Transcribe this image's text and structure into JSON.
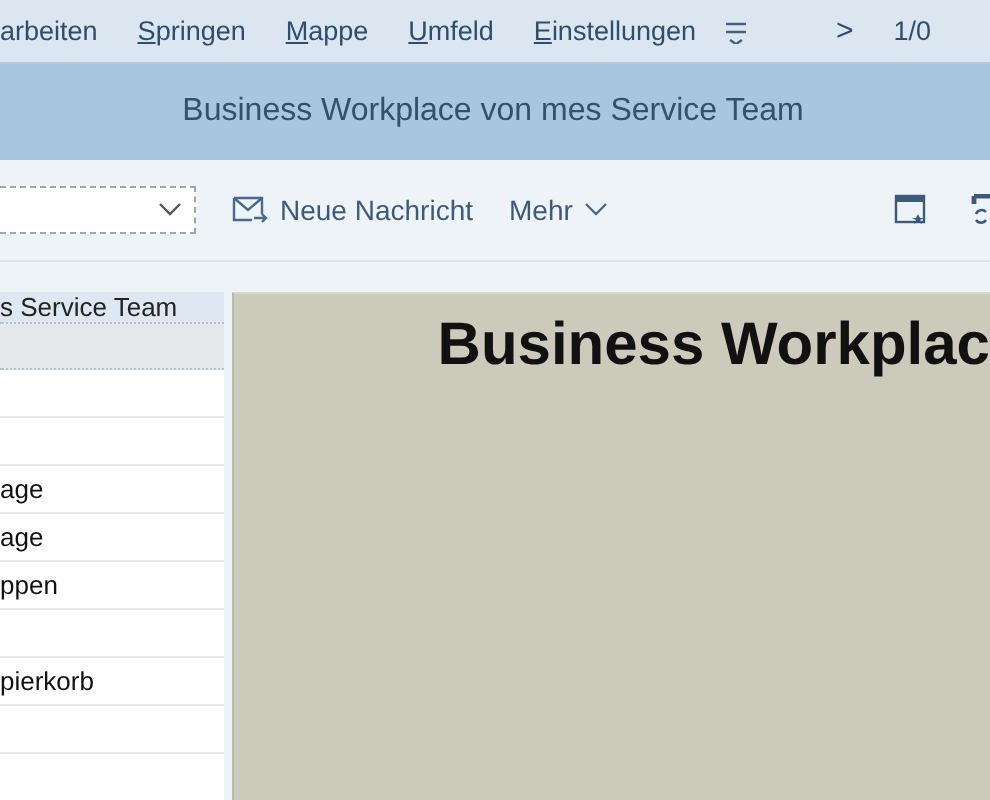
{
  "menu_bar": {
    "items": [
      {
        "label": "arbeiten",
        "mnemonic_first": false
      },
      {
        "label": "Springen",
        "mnemonic_first": true
      },
      {
        "label": "Mappe",
        "mnemonic_first": true
      },
      {
        "label": "Umfeld",
        "mnemonic_first": true
      },
      {
        "label": "Einstellungen",
        "mnemonic_first": true
      }
    ],
    "next": ">",
    "page": "1/0"
  },
  "title": "Business Workplace von mes Service Team",
  "toolbar": {
    "new_message": "Neue Nachricht",
    "more": "Mehr"
  },
  "folder_tree": {
    "header": "s Service Team",
    "rows": [
      {
        "label": "",
        "selected": true
      },
      {
        "label": "",
        "selected": false
      },
      {
        "label": "",
        "selected": false
      },
      {
        "label": "age",
        "selected": false
      },
      {
        "label": "age",
        "selected": false
      },
      {
        "label": "ppen",
        "selected": false
      },
      {
        "label": "",
        "selected": false
      },
      {
        "label": "pierkorb",
        "selected": false
      },
      {
        "label": "",
        "selected": false
      },
      {
        "label": "",
        "selected": false
      }
    ]
  },
  "content": {
    "heading": "Business Workplac"
  }
}
